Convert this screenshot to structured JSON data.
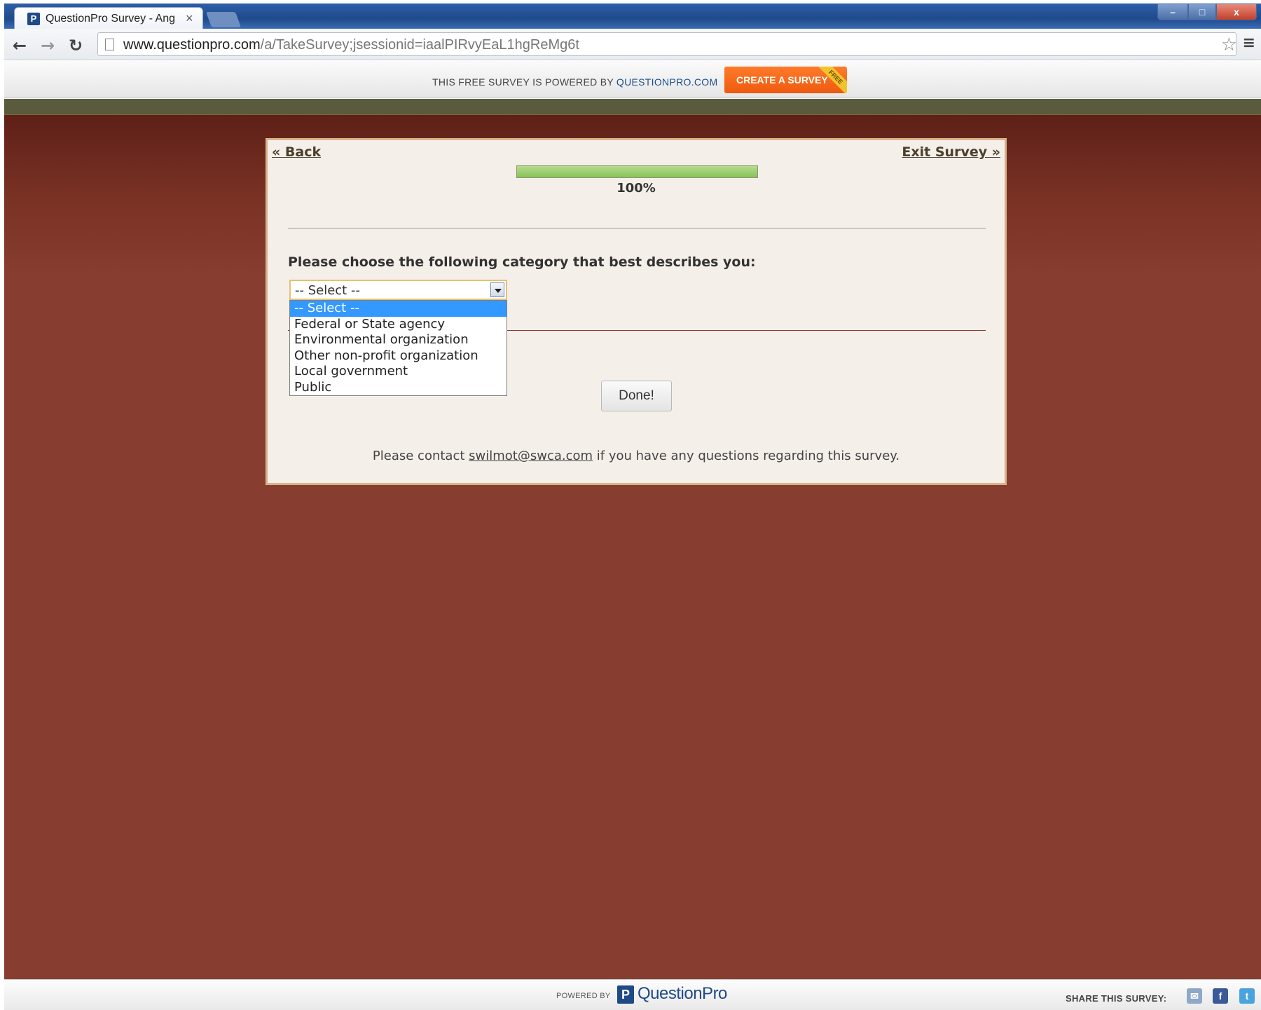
{
  "browser": {
    "tab_title": "QuestionPro Survey - Ang",
    "tab_close": "×",
    "url_host": "www.questionpro.com",
    "url_path": "/a/TakeSurvey;jsessionid=iaalPIRvyEaL1hgReMg6t",
    "window_buttons": {
      "minimize": "–",
      "maximize": "□",
      "close": "x"
    }
  },
  "promo": {
    "text": "THIS FREE SURVEY IS POWERED BY ",
    "brand": "QUESTIONPRO.COM",
    "create_button": "CREATE A SURVEY",
    "ribbon": "FREE"
  },
  "survey": {
    "back_label": "«  Back",
    "exit_label": "Exit Survey  »",
    "progress_value": 1.0,
    "progress_label": "100%",
    "question": "Please choose the following category that best describes you:",
    "select_value": "-- Select --",
    "options": [
      "-- Select --",
      "Federal or State agency",
      "Environmental organization",
      "Other non-profit organization",
      "Local government",
      "Public"
    ],
    "done_label": "Done!",
    "contact_prefix": "Please contact ",
    "contact_email": "swilmot@swca.com",
    "contact_suffix": " if you have any questions regarding this survey."
  },
  "footer": {
    "powered_by": "POWERED BY",
    "logo_text": "QuestionPro",
    "share_label": "SHARE THIS SURVEY:"
  },
  "colors": {
    "page_bg": "#873e31",
    "card_bg": "#f5efea",
    "card_border": "#d8b38a",
    "progress_fill": "#86c25a",
    "create_button": "#ee5a0e",
    "option_highlight": "#3399ff"
  },
  "icons": {
    "back": "arrow-left-icon",
    "forward": "arrow-right-icon",
    "reload": "reload-icon",
    "bookmark": "star-icon",
    "menu": "menu-icon",
    "page": "page-icon",
    "share": [
      "email-icon",
      "facebook-icon",
      "twitter-icon"
    ]
  }
}
